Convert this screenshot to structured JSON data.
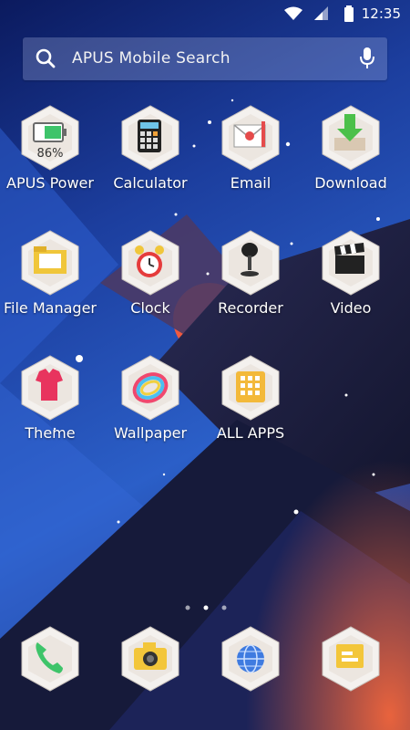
{
  "status_bar": {
    "time": "12:35"
  },
  "search": {
    "placeholder": "APUS Mobile Search"
  },
  "apps": [
    {
      "label": "APUS Power",
      "icon": "battery-icon",
      "badge": "86%"
    },
    {
      "label": "Calculator",
      "icon": "calculator-icon"
    },
    {
      "label": "Email",
      "icon": "email-icon"
    },
    {
      "label": "Download",
      "icon": "download-icon"
    },
    {
      "label": "File Manager",
      "icon": "folder-icon"
    },
    {
      "label": "Clock",
      "icon": "alarm-clock-icon"
    },
    {
      "label": "Recorder",
      "icon": "microphone-icon"
    },
    {
      "label": "Video",
      "icon": "clapperboard-icon"
    },
    {
      "label": "Theme",
      "icon": "shirt-icon"
    },
    {
      "label": "Wallpaper",
      "icon": "rainbow-ring-icon"
    },
    {
      "label": "ALL APPS",
      "icon": "app-grid-icon"
    }
  ],
  "dock": [
    {
      "icon": "phone-icon"
    },
    {
      "icon": "camera-icon"
    },
    {
      "icon": "globe-icon"
    },
    {
      "icon": "messages-icon"
    }
  ],
  "pages": {
    "count": 3,
    "current": 1
  },
  "colors": {
    "sky_top": "#0d1f6e",
    "sky_mid": "#2a55b8",
    "sun": "#f05a3f",
    "mountain": "#1a1c3c",
    "hex_face": "#f4f1ee"
  }
}
